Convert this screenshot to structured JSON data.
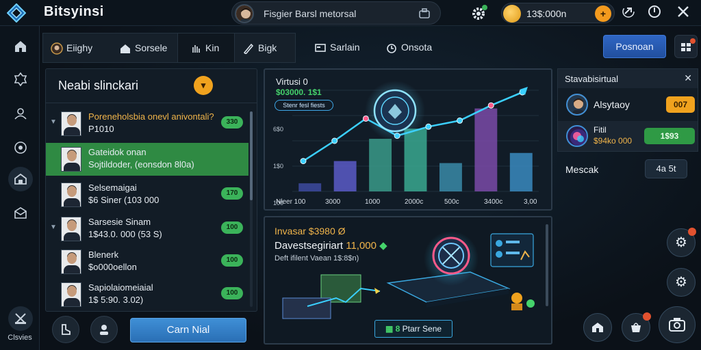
{
  "app": {
    "title": "Bitsyinsi"
  },
  "user": {
    "name": "Fisgier Barsl metorsal"
  },
  "wallet": {
    "balance": "13$:000n",
    "add_label": "+"
  },
  "tabs": [
    {
      "label": "Eiighy"
    },
    {
      "label": "Sorsele"
    },
    {
      "label": "Kin"
    },
    {
      "label": "Bigk"
    },
    {
      "label": "Sarlain"
    },
    {
      "label": "Onsota"
    }
  ],
  "header": {
    "primary_button": "Posnoan"
  },
  "left_panel": {
    "title": "Neabi slinckari",
    "items": [
      {
        "line1": "Poreneholsbia onevl anivontali?",
        "line2": "P1010",
        "badge": "330"
      },
      {
        "line1": "Gateidok onan",
        "line2": "Sojtildoder, (eonsdon 8l0a)",
        "badge": ""
      },
      {
        "line1": "Selsemaigai",
        "line2": "$6 Siner (103 000",
        "badge": "170"
      },
      {
        "line1": "Sarsesie Sinam",
        "line2": "1$43.0. 000 (53 S)",
        "badge": "100"
      },
      {
        "line1": "Blenerk",
        "line2": "$o000oellon",
        "badge": "100"
      },
      {
        "line1": "Sapiolaiomeiaial",
        "line2": "1$ 5:90. 3.02)",
        "badge": "100"
      }
    ]
  },
  "bottom_left": {
    "cta_label": "Carn Nial"
  },
  "left_nav": {
    "bottom_label": "Clsvies"
  },
  "chart": {
    "title": "Virtusi 0",
    "subtitle": "$03000. 1$1",
    "tag": "Stenr fesl fiests"
  },
  "chart_data": {
    "type": "bar",
    "x_labels": [
      "Nleer 100",
      "3000",
      "1000",
      "2000c",
      "500c",
      "3400c",
      "3,00"
    ],
    "y_ticks": [
      "6$0",
      "1$0",
      "100"
    ],
    "bar_values": [
      0.08,
      0.3,
      0.52,
      0.62,
      0.28,
      0.82,
      0.38
    ],
    "line_values": [
      0.3,
      0.5,
      0.72,
      0.55,
      0.64,
      0.7,
      0.85,
      0.98
    ]
  },
  "promo": {
    "line1": "Invasar $3980 Ø",
    "line2_text": "Davestsegiriart",
    "line2_value": "11,000",
    "line3": "Deft ifilent Vaean 1$:8$n)",
    "button_label": "Ptarr Sene",
    "button_prefix": "8"
  },
  "right_panel": {
    "title": "Stavabisirtual",
    "rows": [
      {
        "name": "Alsytaoy",
        "badge": "007"
      },
      {
        "name": "Fitil",
        "sub": "$94ko 000",
        "badge": "1$93"
      }
    ],
    "mescak_label": "Mescak",
    "mescak_value": "4a 5t"
  },
  "colors": {
    "accent": "#f0a21e",
    "green": "#2f9a45",
    "blue": "#2f66c4"
  }
}
